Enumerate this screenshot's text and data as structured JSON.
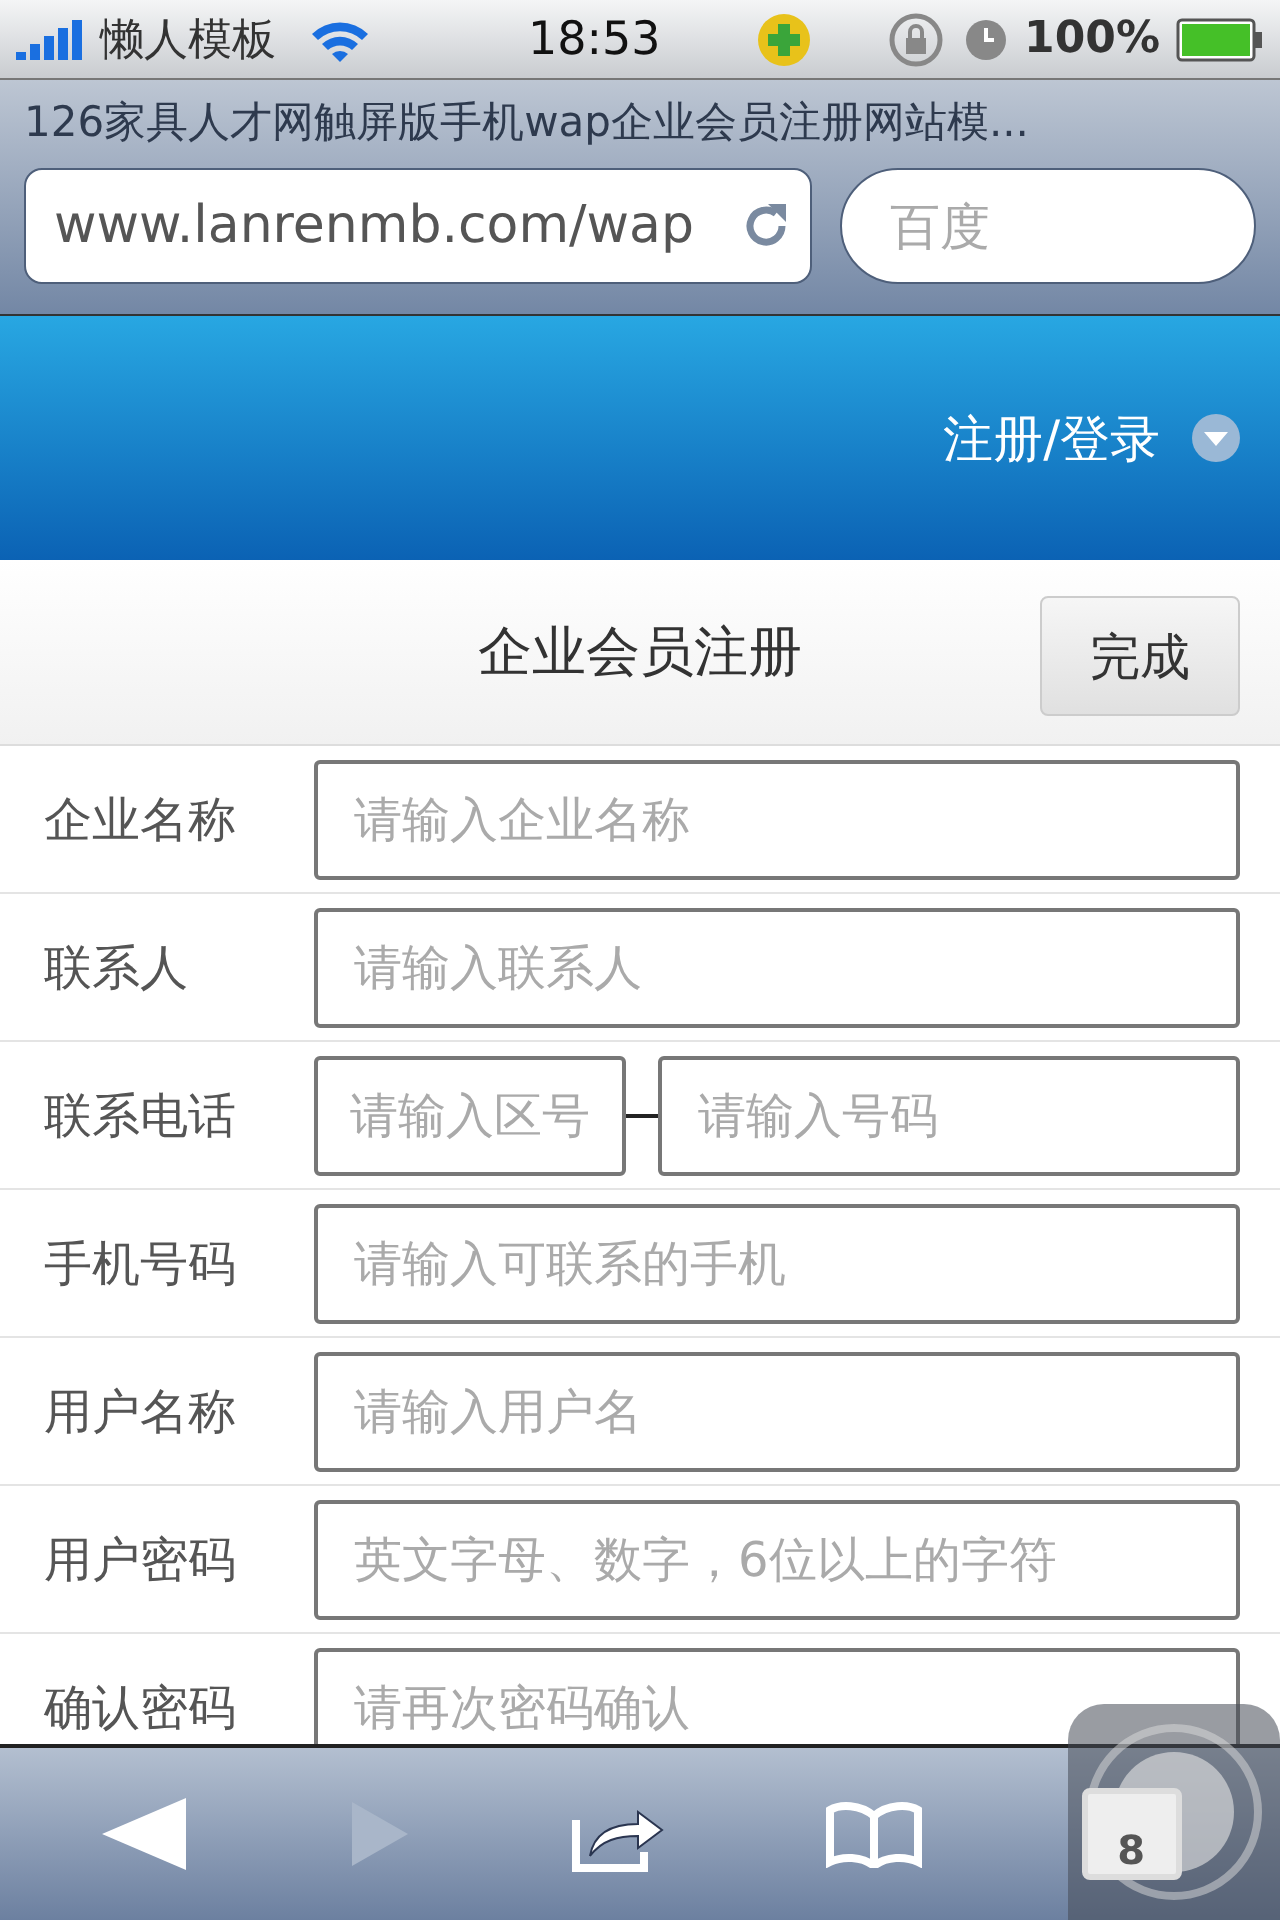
{
  "status_bar": {
    "carrier": "懒人模板",
    "time": "18:53",
    "battery": "100%"
  },
  "browser": {
    "title": "126家具人才网触屏版手机wap企业会员注册网站模...",
    "url": "www.lanrenmb.com/wap",
    "search_placeholder": "百度"
  },
  "header": {
    "menu": "注册/登录"
  },
  "form": {
    "title": "企业会员注册",
    "done_button": "完成",
    "fields": [
      {
        "kind": "single",
        "label": "企业名称",
        "placeholders": [
          "请输入企业名称"
        ]
      },
      {
        "kind": "single",
        "label": "联系人",
        "placeholders": [
          "请输入联系人"
        ]
      },
      {
        "kind": "split",
        "label": "联系电话",
        "placeholders": [
          "请输入区号",
          "请输入号码"
        ]
      },
      {
        "kind": "single",
        "label": "手机号码",
        "placeholders": [
          "请输入可联系的手机"
        ]
      },
      {
        "kind": "single",
        "label": "用户名称",
        "placeholders": [
          "请输入用户名"
        ]
      },
      {
        "kind": "single",
        "label": "用户密码",
        "placeholders": [
          "英文字母、数字，6位以上的字符"
        ]
      },
      {
        "kind": "single",
        "label": "确认密码",
        "placeholders": [
          "请再次密码确认"
        ]
      }
    ]
  },
  "toolbar": {
    "back_disabled": false,
    "forward_disabled": true,
    "tab_count": "8"
  }
}
